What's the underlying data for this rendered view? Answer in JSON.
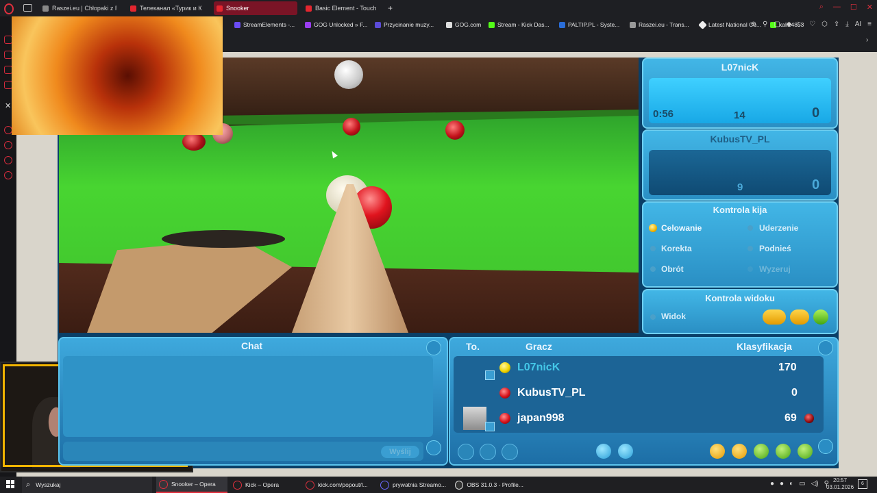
{
  "browser": {
    "tabs": [
      {
        "label": "Raszei.eu | Chłopaki z Ras",
        "active": false
      },
      {
        "label": "Телеканал «Турик и К",
        "active": false
      },
      {
        "label": "Snooker",
        "active": true
      },
      {
        "label": "Basic Element - Touch",
        "active": false
      }
    ],
    "new_tab": "+",
    "bookmarks": [
      "StreamElements -...",
      "GOG Unlocked » F...",
      "Przycinanie muzy...",
      "GOG.com",
      "Stream - Kick Das...",
      "PALTIP.PL - Syste...",
      "Raszei.eu - Trans...",
      "Latest National Co...",
      "kali24853"
    ],
    "ai_label": "AI"
  },
  "game": {
    "player1": {
      "name": "L07nicK",
      "time": "0:56",
      "break": "14",
      "score": "0"
    },
    "player2": {
      "name": "KubusTV_PL",
      "break": "9",
      "score": "0"
    },
    "cue_control": {
      "title": "Kontrola kija",
      "options": [
        "Celowanie",
        "Uderzenie",
        "Korekta",
        "Podnieś",
        "Obrót",
        "Wyzeruj"
      ],
      "selected": "Celowanie"
    },
    "view_control": {
      "title": "Kontrola widoku",
      "option": "Widok"
    },
    "chat": {
      "title": "Chat",
      "send": "Wyślij"
    },
    "players_table": {
      "headers": [
        "To.",
        "Gracz",
        "Klasyfikacja"
      ],
      "rows": [
        {
          "name": "L07nicK",
          "rank": "170",
          "ball": "#f0d400"
        },
        {
          "name": "KubusTV_PL",
          "rank": "0",
          "ball": "#d8131c"
        },
        {
          "name": "japan998",
          "rank": "69",
          "ball": "#d8131c"
        }
      ]
    }
  },
  "taskbar": {
    "search": "Wyszukaj",
    "items": [
      "Snooker – Opera",
      "Kick – Opera",
      "kick.com/popout/l...",
      "prywatnia Streamo...",
      "OBS 31.0.3 - Profile..."
    ],
    "time": "20:57",
    "date": "03.01.2026",
    "notifications": "6"
  }
}
